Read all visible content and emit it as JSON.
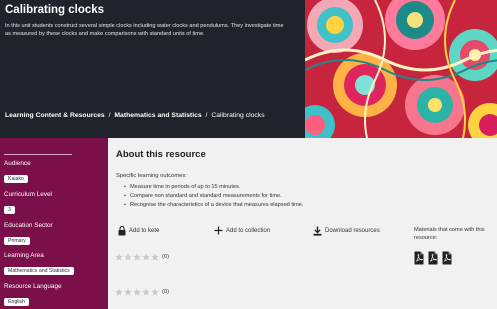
{
  "header": {
    "title": "Calibrating clocks",
    "description": "In this unit students construct several simple clocks including water clocks and pendulums. They investigate time as measured by these clocks and make comparisons with standard units of time.",
    "breadcrumb": {
      "item1": "Learning Content & Resources",
      "item2": "Mathematics and Statistics",
      "current": "Calibrating clocks",
      "separator": "/"
    },
    "colors": {
      "background": "#1f232c",
      "text": "#ffffff"
    }
  },
  "sidebar": {
    "color": "#7a0f4a",
    "audience_label": "Audience",
    "audience_value": "Kaiako",
    "curriculum_label": "Curriculum Level",
    "curriculum_value": "3",
    "sector_label": "Education Sector",
    "sector_value": "Primary",
    "area_label": "Learning Area",
    "area_value": "Mathematics and Statistics",
    "language_label": "Resource Language",
    "language_value": "English"
  },
  "main": {
    "about_title": "About this resource",
    "outcomes_label": "Specific learning outcomes:",
    "outcomes": [
      "Measure time in periods of up to 15 minutes.",
      "Compare non standard and standard measurements for time.",
      "Recognise the characteristics of a device that measures elapsed time."
    ],
    "actions": {
      "add_kete": "Add to kete",
      "add_collection": "Add to collection",
      "download": "Download resources"
    },
    "materials_text": "Materials that come with this resource:",
    "materials_icons": [
      "pdf-icon",
      "pdf-icon",
      "pdf-icon"
    ],
    "rating1": {
      "count": "(0)",
      "stars": 0
    },
    "rating2": {
      "count": "(0)",
      "stars": 0
    }
  }
}
